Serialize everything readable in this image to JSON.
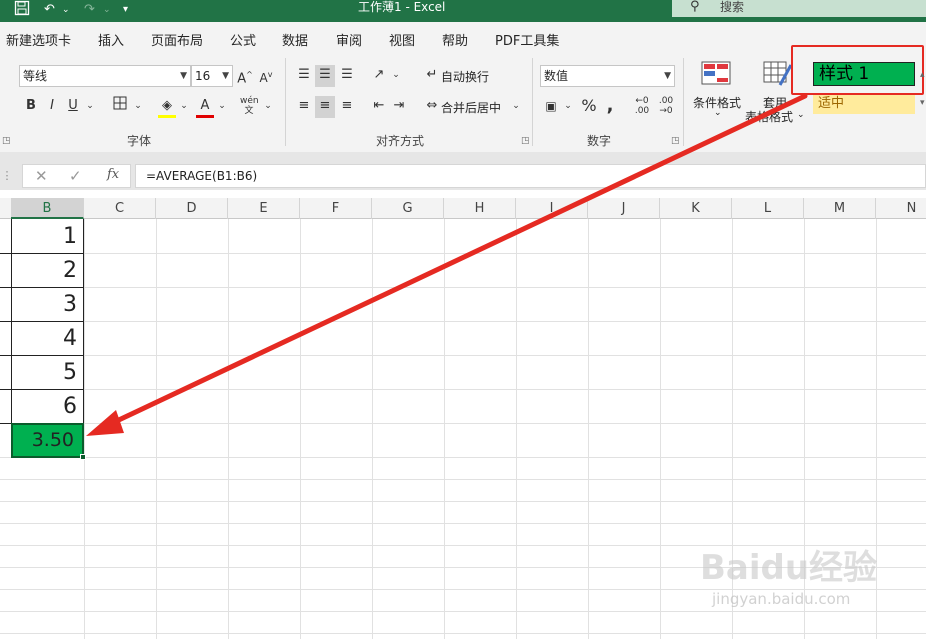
{
  "title_bar": {
    "title": "工作薄1 - Excel",
    "search_label": "搜索",
    "icons": [
      "save-icon",
      "undo-icon",
      "redo-icon",
      "customize-icon"
    ]
  },
  "tabs": [
    "新建选项卡",
    "插入",
    "页面布局",
    "公式",
    "数据",
    "审阅",
    "视图",
    "帮助",
    "PDF工具集"
  ],
  "ribbon": {
    "font": {
      "name": "等线",
      "size": "16",
      "group_label": "字体"
    },
    "alignment": {
      "wrap_label": "自动换行",
      "merge_label": "合并后居中",
      "group_label": "对齐方式"
    },
    "number": {
      "format": "数值",
      "group_label": "数字"
    },
    "styles": {
      "conditional_label": "条件格式",
      "table_label_1": "套用",
      "table_label_2": "表格格式",
      "style1_label": "样式 1",
      "style_mid_label": "适中"
    }
  },
  "formula_bar": {
    "formula": "=AVERAGE(B1:B6)",
    "cancel": "✕",
    "enter": "✓",
    "fx": "fx"
  },
  "grid": {
    "columns": [
      "B",
      "C",
      "D",
      "E",
      "F",
      "G",
      "H",
      "I",
      "J",
      "K",
      "L",
      "M",
      "N"
    ],
    "b_values": [
      "1",
      "2",
      "3",
      "4",
      "5",
      "6"
    ],
    "result": "3.50"
  },
  "colors": {
    "excel_green": "#217346",
    "style1_fill": "#00b050",
    "neutral_fill": "#ffeb9c",
    "annotation_red": "#e52a22"
  },
  "watermark": {
    "brand": "Baidu经验",
    "url": "jingyan.baidu.com"
  }
}
